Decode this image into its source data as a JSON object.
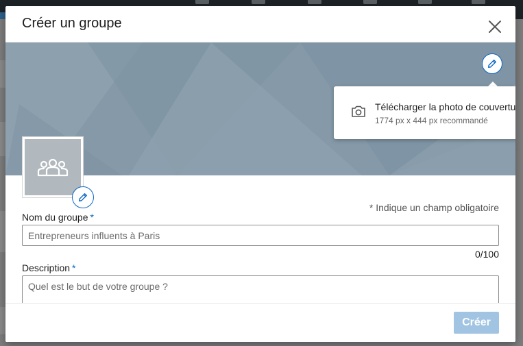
{
  "modal": {
    "title": "Créer un groupe"
  },
  "cover": {
    "upload_label": "Télécharger la photo de couverture",
    "upload_hint": "1774 px x 444 px recommandé"
  },
  "form": {
    "required_note": "* Indique un champ obligatoire",
    "name_label": "Nom du groupe",
    "name_placeholder": "Entrepreneurs influents à Paris",
    "name_counter": "0/100",
    "description_label": "Description",
    "description_placeholder": "Quel est le but de votre groupe ?",
    "required_mark": "*"
  },
  "footer": {
    "create_label": "Créer"
  },
  "colors": {
    "accent": "#0a66c2",
    "cover": "#8599a8",
    "disabled_button": "#a0c4e2"
  },
  "icons": {
    "close": "close-icon",
    "edit": "pencil-icon",
    "camera": "camera-icon",
    "group": "group-icon"
  }
}
